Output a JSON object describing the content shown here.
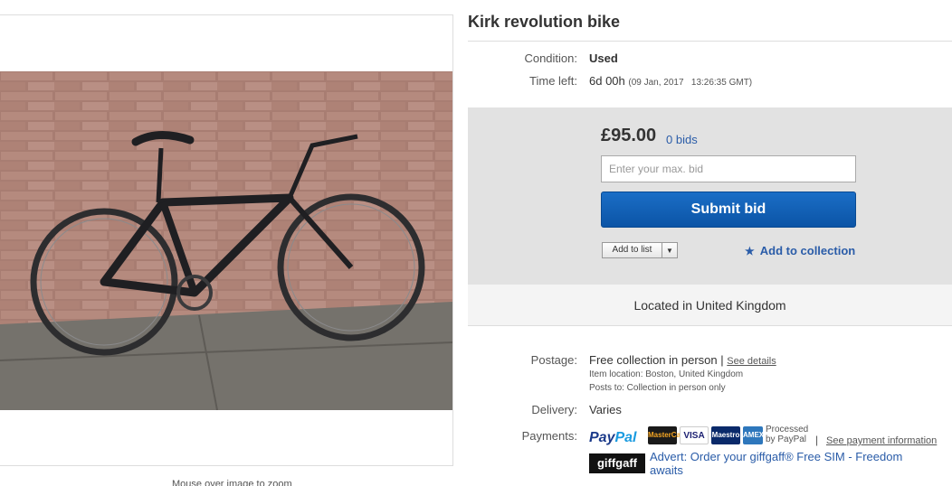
{
  "listing": {
    "title": "Kirk revolution bike",
    "zoom_hint": "Mouse over image to zoom",
    "condition_label": "Condition:",
    "condition_value": "Used",
    "time_left_label": "Time left:",
    "time_left_value": "6d 00h",
    "time_left_end": "(09 Jan, 2017   13:26:35 GMT)"
  },
  "bid": {
    "price": "£95.00",
    "bids": "0 bids",
    "max_bid_placeholder": "Enter your max. bid",
    "submit_label": "Submit bid",
    "add_to_list_label": "Add to list",
    "add_to_collection_label": "Add to collection"
  },
  "location": "Located in United Kingdom",
  "shipping": {
    "postage_label": "Postage:",
    "postage_value": "Free collection in person",
    "postage_separator": "|",
    "see_details": "See details",
    "item_location": "Item location:  Boston, United Kingdom",
    "posts_to": "Posts to:  Collection in person only",
    "delivery_label": "Delivery:",
    "delivery_value": "Varies"
  },
  "payments": {
    "label": "Payments:",
    "paypal_part1": "Pay",
    "paypal_part2": "Pal",
    "cards": [
      "MasterCard",
      "VISA",
      "Maestro",
      "AMEX"
    ],
    "processed": "Processed",
    "by_paypal": "by PayPal",
    "separator": "|",
    "see_payment_info": "See payment information"
  },
  "advert": {
    "logo": "giffgaff",
    "text": "Advert: Order your giffgaff® Free SIM - Freedom awaits"
  },
  "colors": {
    "link_blue": "#2a5ca8",
    "button_blue": "#0b54a6",
    "bid_panel_bg": "#e2e2e2"
  }
}
